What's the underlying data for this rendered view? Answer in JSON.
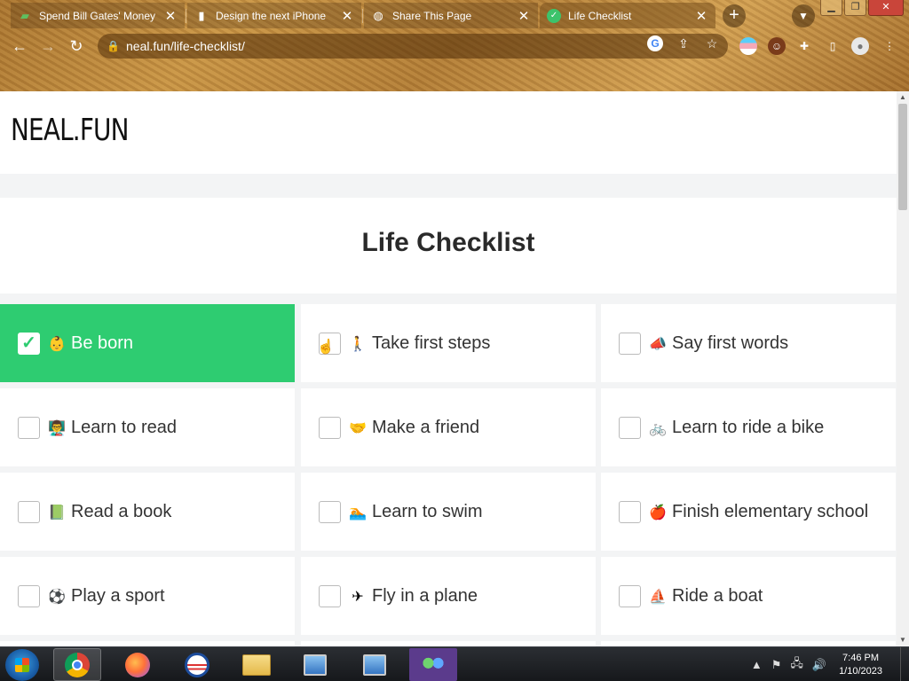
{
  "browser": {
    "tabs": [
      {
        "title": "Spend Bill Gates' Money",
        "favicon": "money-icon",
        "active": false
      },
      {
        "title": "Design the next iPhone",
        "favicon": "phone-icon",
        "active": false
      },
      {
        "title": "Share This Page",
        "favicon": "globe-icon",
        "active": false
      },
      {
        "title": "Life Checklist",
        "favicon": "checkmark-icon",
        "active": true
      }
    ],
    "close_glyph": "✕",
    "new_tab_glyph": "+",
    "url": "neal.fun/life-checklist/"
  },
  "site": {
    "logo": "NEAL.FUN",
    "title": "Life Checklist"
  },
  "checklist": [
    {
      "label": "Be born",
      "emoji": "👶",
      "checked": true
    },
    {
      "label": "Take first steps",
      "emoji": "🚶",
      "checked": false
    },
    {
      "label": "Say first words",
      "emoji": "📣",
      "checked": false
    },
    {
      "label": "Learn to read",
      "emoji": "👨‍🏫",
      "checked": false
    },
    {
      "label": "Make a friend",
      "emoji": "🤝",
      "checked": false
    },
    {
      "label": "Learn to ride a bike",
      "emoji": "🚲",
      "checked": false
    },
    {
      "label": "Read a book",
      "emoji": "📗",
      "checked": false
    },
    {
      "label": "Learn to swim",
      "emoji": "🏊",
      "checked": false
    },
    {
      "label": "Finish elementary school",
      "emoji": "🍎",
      "checked": false
    },
    {
      "label": "Play a sport",
      "emoji": "⚽",
      "checked": false
    },
    {
      "label": "Fly in a plane",
      "emoji": "✈",
      "checked": false
    },
    {
      "label": "Ride a boat",
      "emoji": "⛵",
      "checked": false
    }
  ],
  "taskbar": {
    "time": "7:46 PM",
    "date": "1/10/2023"
  }
}
